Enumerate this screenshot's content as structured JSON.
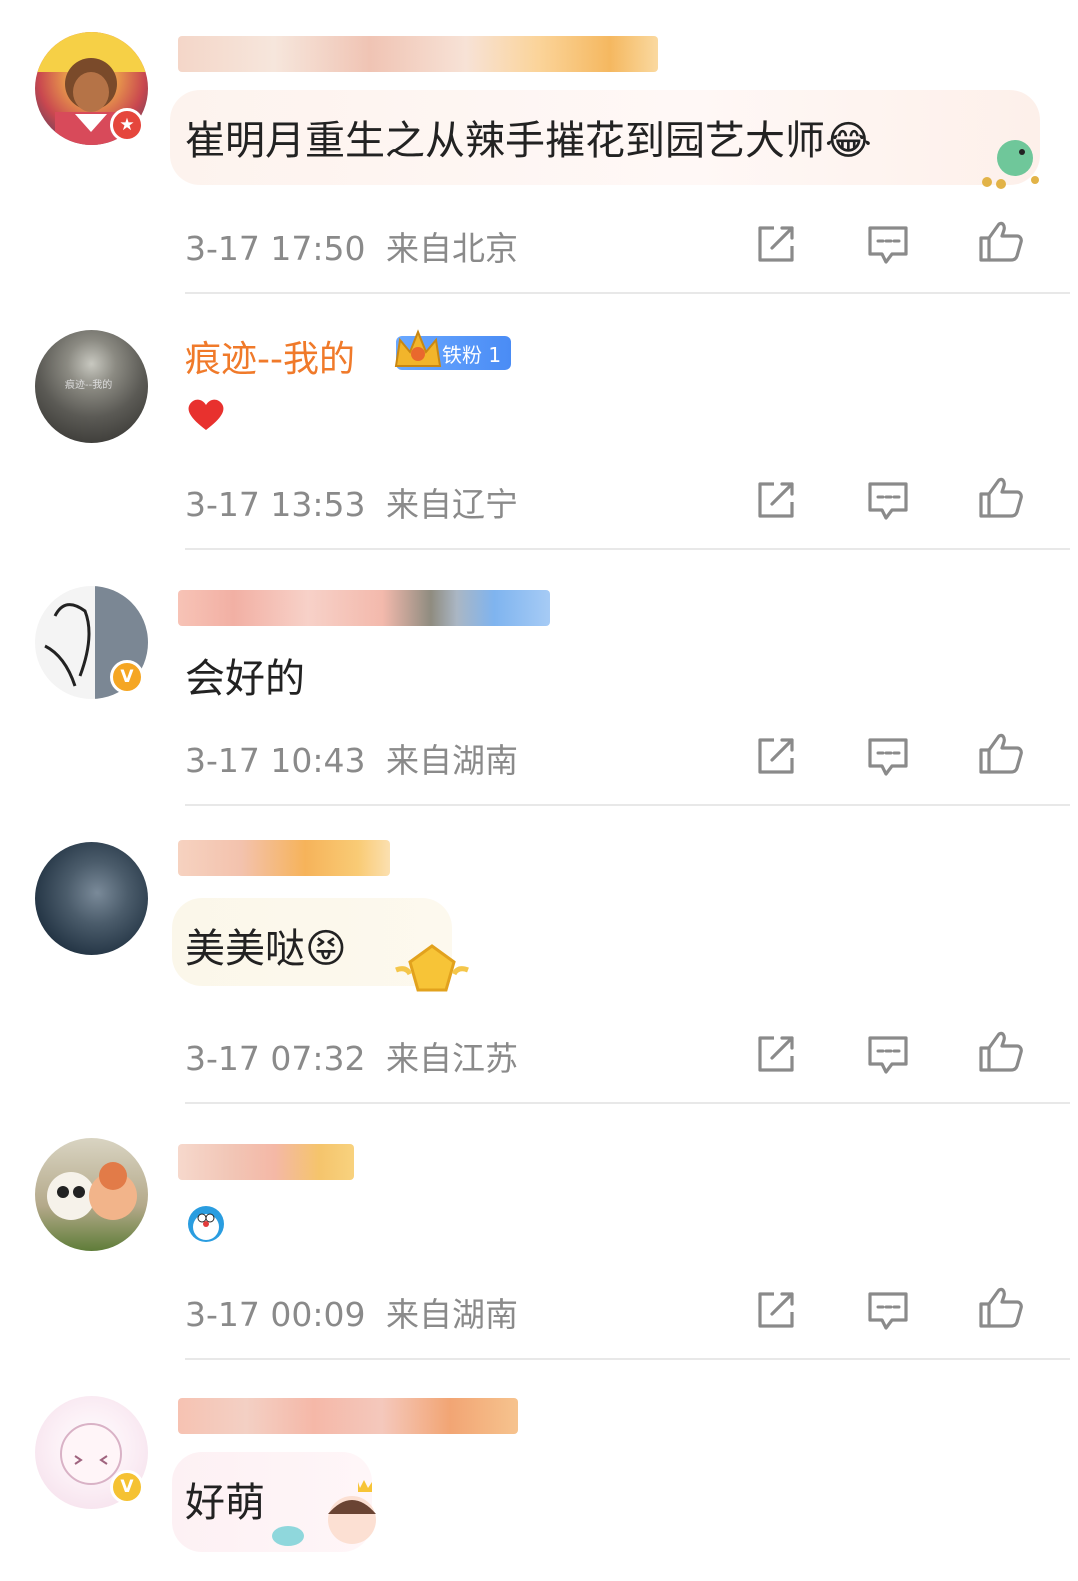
{
  "comments": [
    {
      "username": "",
      "text": "崔明月重生之从辣手摧花到园艺大师😂",
      "time": "3-17 17:50",
      "location": "来自北京"
    },
    {
      "username": "痕迹--我的",
      "badge": "铁粉 1",
      "avatar_text": "痕迹--我的",
      "text": "❤️",
      "time": "3-17 13:53",
      "location": "来自辽宁"
    },
    {
      "username": "",
      "text": "会好的",
      "time": "3-17 10:43",
      "location": "来自湖南"
    },
    {
      "username": "",
      "text": "美美哒😝",
      "time": "3-17 07:32",
      "location": "来自江苏"
    },
    {
      "username": "",
      "text": "",
      "time": "3-17 00:09",
      "location": "来自湖南"
    },
    {
      "username": "",
      "text": "好萌",
      "time": "",
      "location": ""
    }
  ],
  "icons": {
    "share": "share-icon",
    "comment": "comment-icon",
    "like": "thumbs-up-icon"
  },
  "colors": {
    "username_orange": "#f07a2a",
    "fan_badge_blue": "#4a8cf5",
    "verified_orange": "#f5a623",
    "meta_gray": "#8a8a8a"
  }
}
